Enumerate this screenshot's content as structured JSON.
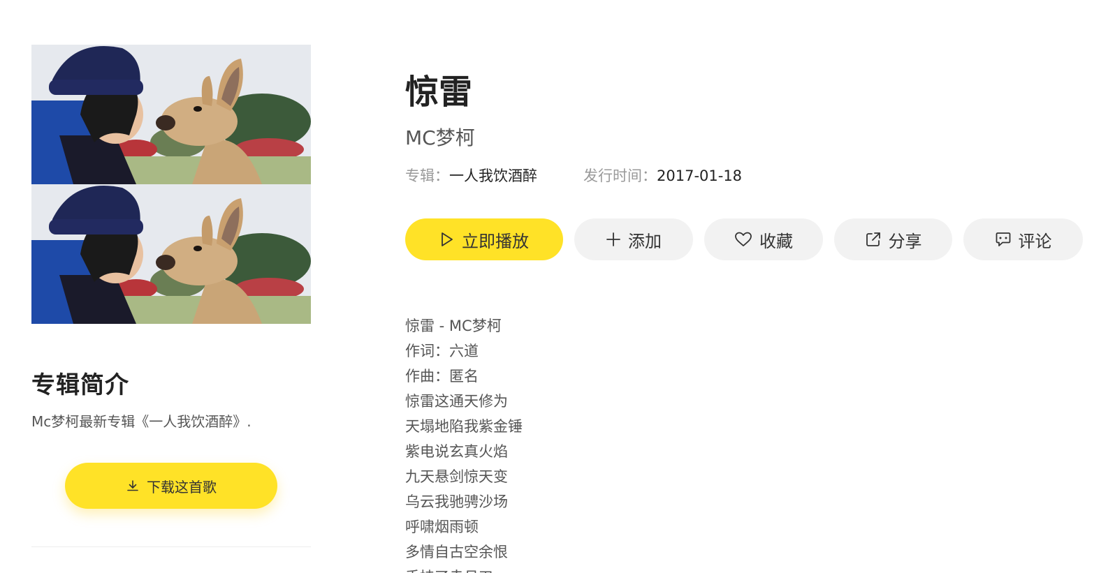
{
  "song": {
    "title": "惊雷",
    "artist": "MC梦柯",
    "album_label": "专辑：",
    "album": "一人我饮酒醉",
    "release_label": "发行时间：",
    "release_date": "2017-01-18"
  },
  "actions": {
    "play": {
      "label": "立即播放",
      "icon": "play-icon"
    },
    "add": {
      "label": "添加",
      "icon": "plus-icon"
    },
    "favorite": {
      "label": "收藏",
      "icon": "heart-icon"
    },
    "share": {
      "label": "分享",
      "icon": "share-icon"
    },
    "comment": {
      "label": "评论",
      "icon": "comment-icon"
    }
  },
  "album_intro": {
    "title": "专辑简介",
    "text": "Mc梦柯最新专辑《一人我饮酒醉》."
  },
  "download": {
    "label": "下载这首歌",
    "icon": "download-icon"
  },
  "lyrics": [
    "惊雷 - MC梦柯",
    "作词：六道",
    "作曲：匿名",
    "惊雷这通天修为",
    "天塌地陷我紫金锤",
    "紫电说玄真火焰",
    "九天悬剑惊天变",
    "乌云我驰骋沙场",
    "呼啸烟雨顿",
    "多情自古空余恨",
    "手持了赤月刃"
  ],
  "colors": {
    "accent": "#ffe227",
    "button_bg": "#f2f2f2"
  }
}
